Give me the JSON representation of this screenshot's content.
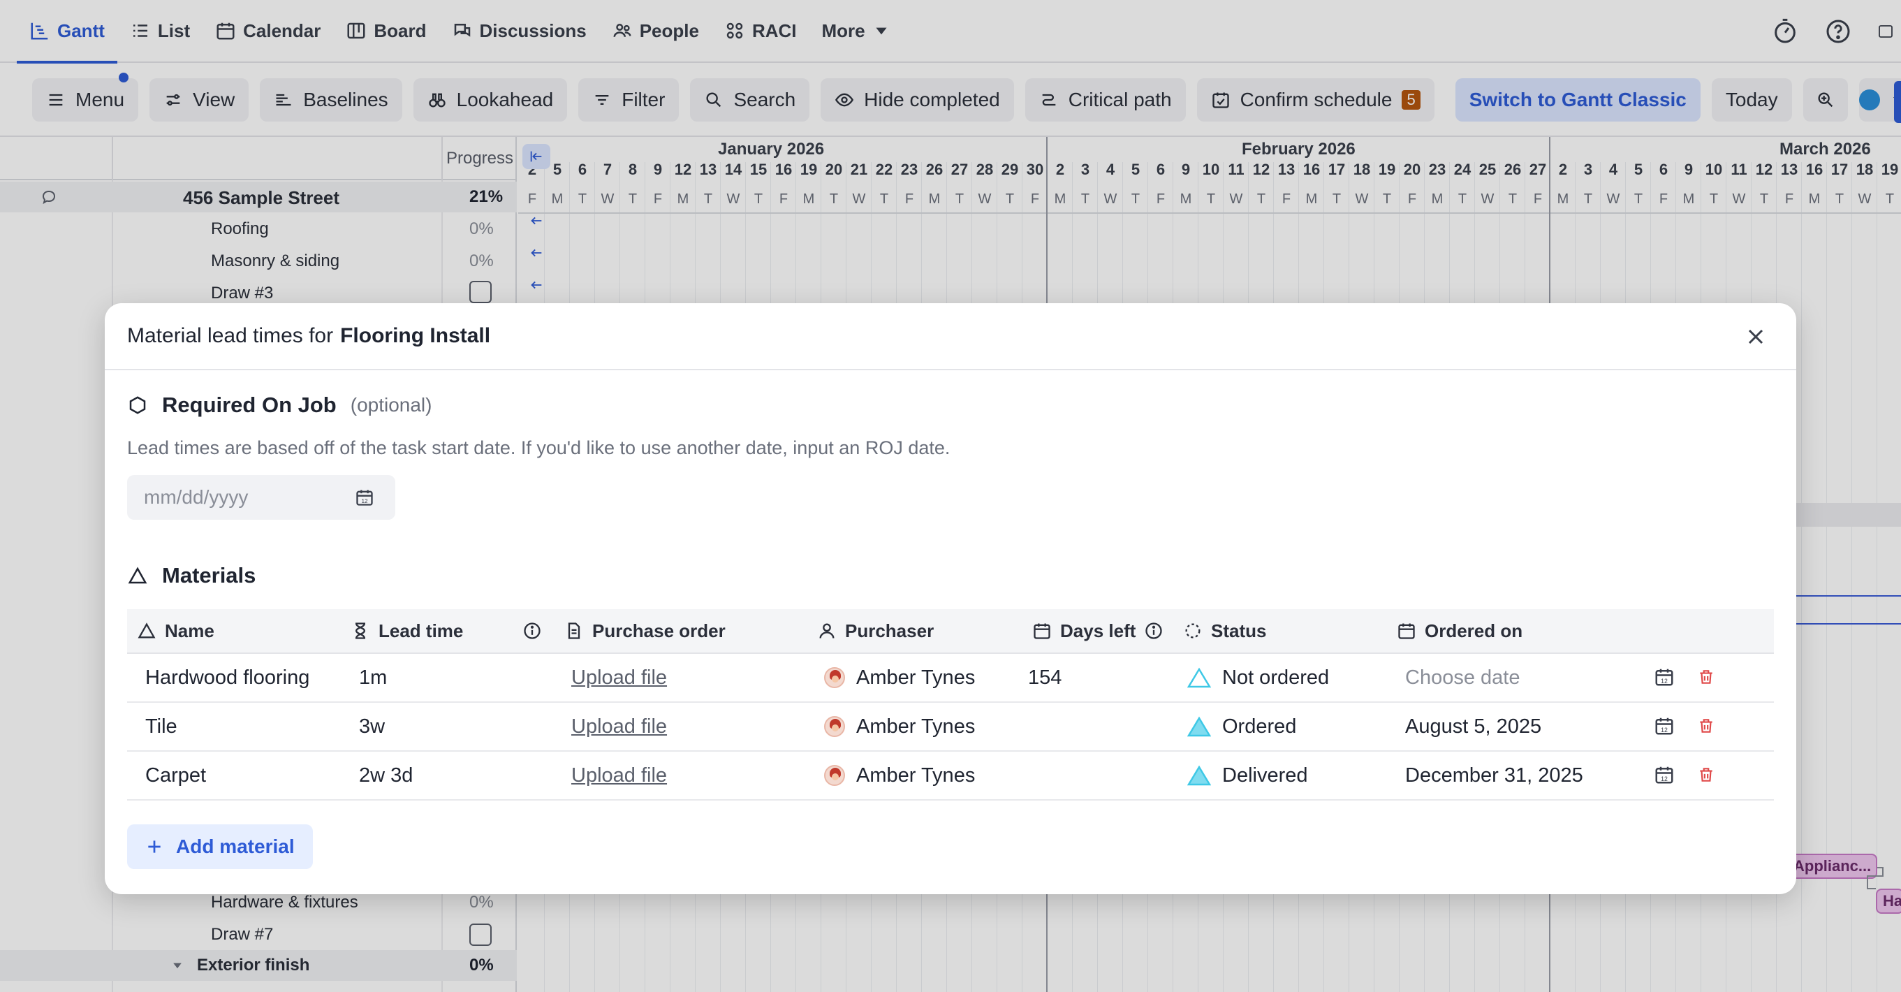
{
  "nav": {
    "tabs": [
      {
        "label": "Gantt"
      },
      {
        "label": "List"
      },
      {
        "label": "Calendar"
      },
      {
        "label": "Board"
      },
      {
        "label": "Discussions"
      },
      {
        "label": "People"
      },
      {
        "label": "RACI"
      },
      {
        "label": "More"
      }
    ]
  },
  "toolbar": {
    "menu": "Menu",
    "view": "View",
    "baselines": "Baselines",
    "lookahead": "Lookahead",
    "filter": "Filter",
    "search": "Search",
    "hide_completed": "Hide completed",
    "critical_path": "Critical path",
    "confirm_schedule": "Confirm schedule",
    "confirm_count": "5",
    "switch_classic": "Switch to Gantt Classic",
    "today": "Today",
    "color_dot": "#2a8fd9"
  },
  "grid": {
    "progress_header": "Progress",
    "rows": [
      {
        "name": "456 Sample Street",
        "pct": "21%"
      },
      {
        "name": "Roofing",
        "pct": "0%"
      },
      {
        "name": "Masonry & siding",
        "pct": "0%"
      },
      {
        "name": "Draw #3"
      },
      {
        "name": "Hardware & fixtures",
        "pct": "0%"
      },
      {
        "name": "Draw #7"
      },
      {
        "name": "Exterior finish",
        "pct": "0%"
      }
    ]
  },
  "timeline": {
    "months": [
      "January 2026",
      "February 2026",
      "March 2026"
    ],
    "days": [
      "2",
      "5",
      "6",
      "7",
      "8",
      "9",
      "12",
      "13",
      "14",
      "15",
      "16",
      "19",
      "20",
      "21",
      "22",
      "23",
      "26",
      "27",
      "28",
      "29",
      "30",
      "2",
      "3",
      "4",
      "5",
      "6",
      "9",
      "10",
      "11",
      "12",
      "13",
      "16",
      "17",
      "18",
      "19",
      "20",
      "23",
      "24",
      "25",
      "26",
      "27",
      "2",
      "3",
      "4",
      "5",
      "6",
      "9",
      "10",
      "11",
      "12",
      "13",
      "16",
      "17",
      "18",
      "19"
    ],
    "weekdays": [
      "F",
      "M",
      "T",
      "W",
      "T",
      "F",
      "M",
      "T",
      "W",
      "T",
      "F",
      "M",
      "T",
      "W",
      "T",
      "F",
      "M",
      "T",
      "W",
      "T",
      "F",
      "M",
      "T",
      "W",
      "T",
      "F",
      "M",
      "T",
      "W",
      "T",
      "F",
      "M",
      "T",
      "W",
      "T",
      "F",
      "M",
      "T",
      "W",
      "T",
      "F",
      "M",
      "T",
      "W",
      "T",
      "F",
      "M",
      "T",
      "W",
      "T",
      "F",
      "M",
      "T",
      "W",
      "T"
    ],
    "bars": [
      {
        "label": "Applianc..."
      },
      {
        "label": "Ha"
      }
    ]
  },
  "modal": {
    "title_prefix": "Material lead times for",
    "title_task": "Flooring Install",
    "roj": {
      "title": "Required On Job",
      "optional": "(optional)",
      "help": "Lead times are based off of the task start date. If you'd like to use another date, input an ROJ date.",
      "placeholder": "mm/dd/yyyy"
    },
    "materials": {
      "title": "Materials",
      "columns": {
        "name": "Name",
        "lead_time": "Lead time",
        "purchase_order": "Purchase order",
        "purchaser": "Purchaser",
        "days_left": "Days left",
        "status": "Status",
        "ordered_on": "Ordered on"
      },
      "rows": [
        {
          "name": "Hardwood flooring",
          "lead_time": "1m",
          "po": "Upload file",
          "purchaser": "Amber Tynes",
          "days_left": "154",
          "status": "Not ordered",
          "ordered_on": "Choose date"
        },
        {
          "name": "Tile",
          "lead_time": "3w",
          "po": "Upload file",
          "purchaser": "Amber Tynes",
          "days_left": "",
          "status": "Ordered",
          "ordered_on": "August 5, 2025"
        },
        {
          "name": "Carpet",
          "lead_time": "2w 3d",
          "po": "Upload file",
          "purchaser": "Amber Tynes",
          "days_left": "",
          "status": "Delivered",
          "ordered_on": "December 31, 2025"
        }
      ],
      "add_label": "Add material"
    }
  }
}
